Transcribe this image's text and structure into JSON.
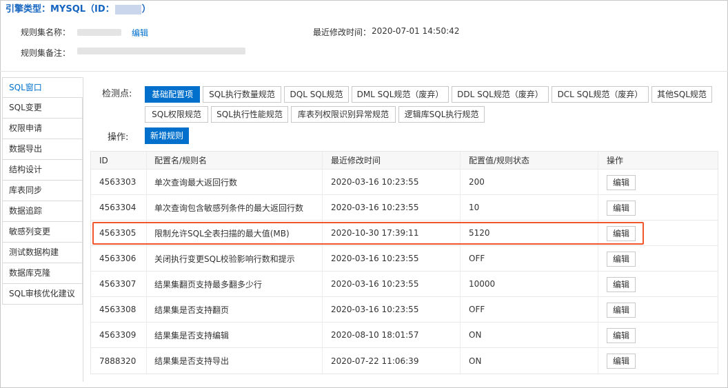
{
  "header": {
    "title_prefix": "引擎类型：MYSQL（ID：",
    "title_suffix": "）",
    "ruleset_name_label": "规则集名称：",
    "edit_link": "编辑",
    "modified_label": "最近修改时间：",
    "modified_value": "2020-07-01 14:50:42",
    "remark_label": "规则集备注："
  },
  "sidebar": {
    "items": [
      {
        "label": "SQL窗口",
        "active": true
      },
      {
        "label": "SQL变更"
      },
      {
        "label": "权限申请"
      },
      {
        "label": "数据导出"
      },
      {
        "label": "结构设计"
      },
      {
        "label": "库表同步"
      },
      {
        "label": "数据追踪"
      },
      {
        "label": "敏感列变更"
      },
      {
        "label": "测试数据构建"
      },
      {
        "label": "数据库克隆"
      },
      {
        "label": "SQL审核优化建议"
      }
    ]
  },
  "checkpoint": {
    "label": "检测点:",
    "tags": [
      "基础配置项",
      "SQL执行数量规范",
      "DQL SQL规范",
      "DML SQL规范（废弃）",
      "DDL SQL规范（废弃）",
      "DCL SQL规范（废弃）",
      "其他SQL规范",
      "SQL权限规范",
      "SQL执行性能规范",
      "库表列权限识别异常规范",
      "逻辑库SQL执行规范"
    ],
    "active_index": 0
  },
  "operation": {
    "label": "操作:",
    "add_rule_button": "新增规则"
  },
  "table": {
    "columns": [
      "ID",
      "配置名/规则名",
      "最近修改时间",
      "配置值/规则状态",
      "操作"
    ],
    "rows": [
      {
        "id": "4563303",
        "name": "单次查询最大返回行数",
        "time": "2020-03-16 10:23:55",
        "value": "200",
        "action": "编辑"
      },
      {
        "id": "4563304",
        "name": "单次查询包含敏感列条件的最大返回行数",
        "time": "2020-03-16 10:23:55",
        "value": "10",
        "action": "编辑"
      },
      {
        "id": "4563305",
        "name": "限制允许SQL全表扫描的最大值(MB)",
        "time": "2020-10-30 17:39:11",
        "value": "5120",
        "action": "编辑",
        "highlighted": true
      },
      {
        "id": "4563306",
        "name": "关闭执行变更SQL校验影响行数和提示",
        "time": "2020-03-16 10:23:55",
        "value": "OFF",
        "action": "编辑"
      },
      {
        "id": "4563307",
        "name": "结果集翻页支持最多翻多少行",
        "time": "2020-03-16 10:23:55",
        "value": "10000",
        "action": "编辑"
      },
      {
        "id": "4563308",
        "name": "结果集是否支持翻页",
        "time": "2020-03-16 10:23:55",
        "value": "OFF",
        "action": "编辑"
      },
      {
        "id": "4563309",
        "name": "结果集是否支持编辑",
        "time": "2020-08-10 18:01:57",
        "value": "ON",
        "action": "编辑"
      },
      {
        "id": "7888320",
        "name": "结果集是否支持导出",
        "time": "2020-07-22 11:06:39",
        "value": "ON",
        "action": "编辑"
      }
    ]
  },
  "colors": {
    "accent": "#0070cc",
    "highlight": "#f0552c"
  }
}
